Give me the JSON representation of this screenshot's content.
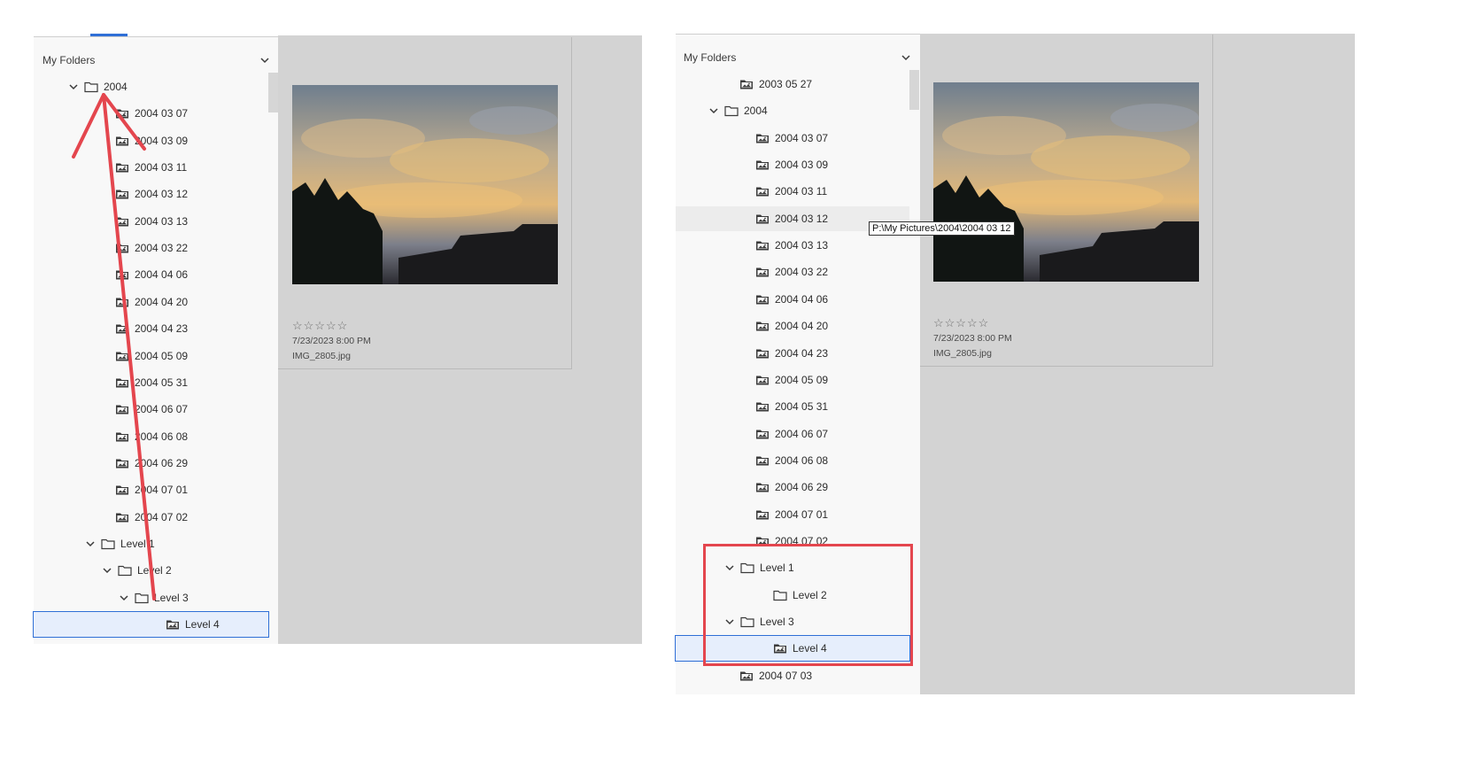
{
  "left": {
    "section_title": "My Folders",
    "tree": [
      {
        "label": "2004",
        "kind": "folder-open",
        "expanded": true
      },
      {
        "label": "2004 03 07",
        "kind": "image-folder"
      },
      {
        "label": "2004 03 09",
        "kind": "image-folder"
      },
      {
        "label": "2004 03 11",
        "kind": "image-folder"
      },
      {
        "label": "2004 03 12",
        "kind": "image-folder"
      },
      {
        "label": "2004 03 13",
        "kind": "image-folder"
      },
      {
        "label": "2004 03 22",
        "kind": "image-folder"
      },
      {
        "label": "2004 04 06",
        "kind": "image-folder"
      },
      {
        "label": "2004 04 20",
        "kind": "image-folder"
      },
      {
        "label": "2004 04 23",
        "kind": "image-folder"
      },
      {
        "label": "2004 05 09",
        "kind": "image-folder"
      },
      {
        "label": "2004 05 31",
        "kind": "image-folder"
      },
      {
        "label": "2004 06 07",
        "kind": "image-folder"
      },
      {
        "label": "2004 06 08",
        "kind": "image-folder"
      },
      {
        "label": "2004 06 29",
        "kind": "image-folder"
      },
      {
        "label": "2004 07 01",
        "kind": "image-folder"
      },
      {
        "label": "2004 07 02",
        "kind": "image-folder"
      },
      {
        "label": "Level 1",
        "kind": "folder-open",
        "expanded": true
      },
      {
        "label": "Level 2",
        "kind": "folder-open",
        "expanded": true
      },
      {
        "label": "Level 3",
        "kind": "folder-open",
        "expanded": true
      },
      {
        "label": "Level 4",
        "kind": "image-folder",
        "selected": true
      }
    ],
    "card": {
      "rating": "☆☆☆☆☆",
      "date": "7/23/2023 8:00 PM",
      "filename": "IMG_2805.jpg"
    }
  },
  "right": {
    "section_title": "My Folders",
    "tree": [
      {
        "label": "2003 05 27",
        "kind": "image-folder"
      },
      {
        "label": "2004",
        "kind": "folder-open",
        "expanded": true
      },
      {
        "label": "2004 03 07",
        "kind": "image-folder"
      },
      {
        "label": "2004 03 09",
        "kind": "image-folder"
      },
      {
        "label": "2004 03 11",
        "kind": "image-folder"
      },
      {
        "label": "2004 03 12",
        "kind": "image-folder",
        "hovered": true
      },
      {
        "label": "2004 03 13",
        "kind": "image-folder"
      },
      {
        "label": "2004 03 22",
        "kind": "image-folder"
      },
      {
        "label": "2004 04 06",
        "kind": "image-folder"
      },
      {
        "label": "2004 04 20",
        "kind": "image-folder"
      },
      {
        "label": "2004 04 23",
        "kind": "image-folder"
      },
      {
        "label": "2004 05 09",
        "kind": "image-folder"
      },
      {
        "label": "2004 05 31",
        "kind": "image-folder"
      },
      {
        "label": "2004 06 07",
        "kind": "image-folder"
      },
      {
        "label": "2004 06 08",
        "kind": "image-folder"
      },
      {
        "label": "2004 06 29",
        "kind": "image-folder"
      },
      {
        "label": "2004 07 01",
        "kind": "image-folder"
      },
      {
        "label": "2004 07 02",
        "kind": "image-folder"
      },
      {
        "label": "Level 1",
        "kind": "folder-open",
        "expanded": true
      },
      {
        "label": "Level 2",
        "kind": "folder"
      },
      {
        "label": "Level 3",
        "kind": "folder-open",
        "expanded": true
      },
      {
        "label": "Level 4",
        "kind": "image-folder",
        "selected": true
      },
      {
        "label": "2004 07 03",
        "kind": "image-folder"
      }
    ],
    "tooltip": "P:\\My Pictures\\2004\\2004 03 12",
    "card": {
      "rating": "☆☆☆☆☆",
      "date": "7/23/2023 8:00 PM",
      "filename": "IMG_2805.jpg"
    }
  },
  "annotation_color": "#e4464e",
  "selection_color": "#2f6fd6"
}
